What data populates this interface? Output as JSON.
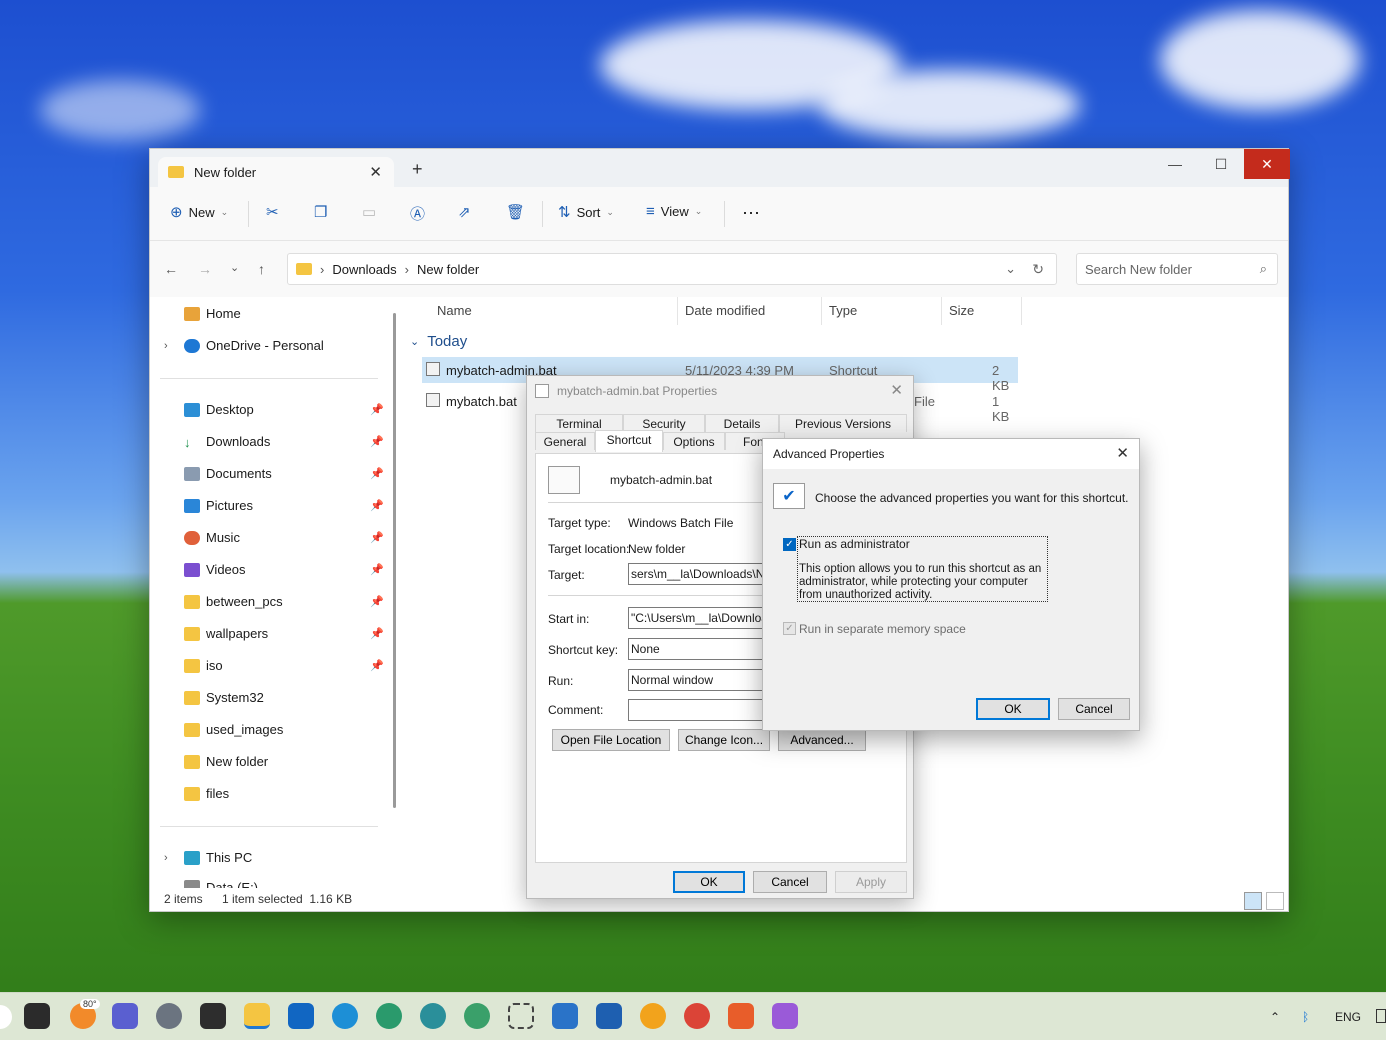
{
  "explorer": {
    "tab_title": "New folder",
    "toolbar": {
      "new": "New",
      "sort": "Sort",
      "view": "View"
    },
    "breadcrumb": [
      "Downloads",
      "New folder"
    ],
    "search_placeholder": "Search New folder",
    "sidebar": {
      "top": [
        {
          "label": "Home"
        },
        {
          "label": "OneDrive - Personal"
        }
      ],
      "quick": [
        {
          "label": "Desktop",
          "pinned": true
        },
        {
          "label": "Downloads",
          "pinned": true
        },
        {
          "label": "Documents",
          "pinned": true
        },
        {
          "label": "Pictures",
          "pinned": true
        },
        {
          "label": "Music",
          "pinned": true
        },
        {
          "label": "Videos",
          "pinned": true
        },
        {
          "label": "between_pcs",
          "pinned": true
        },
        {
          "label": "wallpapers",
          "pinned": true
        },
        {
          "label": "iso",
          "pinned": true
        },
        {
          "label": "System32",
          "pinned": false
        },
        {
          "label": "used_images",
          "pinned": false
        },
        {
          "label": "New folder",
          "pinned": false
        },
        {
          "label": "files",
          "pinned": false
        }
      ],
      "bottom": [
        {
          "label": "This PC"
        },
        {
          "label": "Data (E:)"
        }
      ]
    },
    "columns": {
      "name": "Name",
      "date": "Date modified",
      "type": "Type",
      "size": "Size"
    },
    "group": "Today",
    "files": [
      {
        "name": "mybatch-admin.bat",
        "date": "5/11/2023 4:39 PM",
        "type": "Shortcut",
        "size": "2 KB",
        "selected": true
      },
      {
        "name": "mybatch.bat",
        "date": "",
        "type": "File",
        "size": "1 KB",
        "selected": false
      }
    ],
    "status": {
      "count": "2 items",
      "selection": "1 item selected  1.16 KB"
    }
  },
  "properties": {
    "title": "mybatch-admin.bat Properties",
    "tabs_row1": [
      "Terminal",
      "Security",
      "Details",
      "Previous Versions"
    ],
    "tabs_row2": [
      "General",
      "Shortcut",
      "Options",
      "Font"
    ],
    "file_name": "mybatch-admin.bat",
    "target_type_label": "Target type:",
    "target_type": "Windows Batch File",
    "target_location_label": "Target location:",
    "target_location": "New folder",
    "target_label": "Target:",
    "target": "sers\\m__la\\Downloads\\New folder\\mybatch.bat",
    "start_in_label": "Start in:",
    "start_in": "\"C:\\Users\\m__la\\Downloads\\New folder\"",
    "shortcut_key_label": "Shortcut key:",
    "shortcut_key": "None",
    "run_label": "Run:",
    "run": "Normal window",
    "comment_label": "Comment:",
    "comment": "",
    "btn_open": "Open File Location",
    "btn_icon": "Change Icon...",
    "btn_adv": "Advanced...",
    "ok": "OK",
    "cancel": "Cancel",
    "apply": "Apply"
  },
  "advanced": {
    "title": "Advanced Properties",
    "heading": "Choose the advanced properties you want for this shortcut.",
    "run_admin": "Run as administrator",
    "run_admin_checked": true,
    "description": "This option allows you to run this shortcut as an administrator, while protecting your computer from unauthorized activity.",
    "separate_memory": "Run in separate memory space",
    "ok": "OK",
    "cancel": "Cancel"
  },
  "taskbar": {
    "weather": "80°",
    "language": "ENG",
    "accent": "#dde7d4"
  }
}
